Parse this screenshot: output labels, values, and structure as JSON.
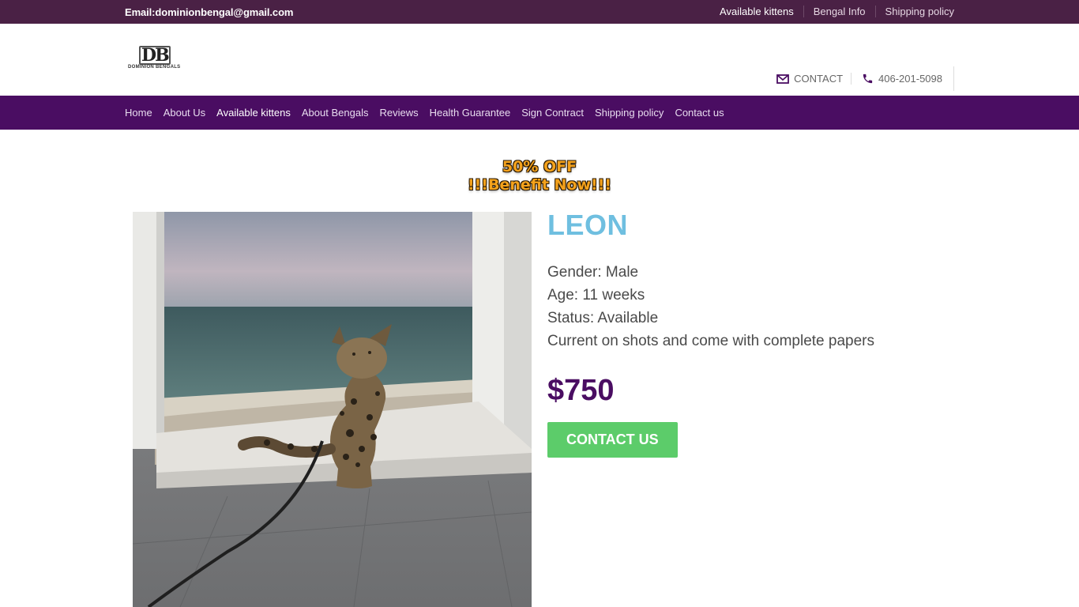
{
  "topbar": {
    "email": "Email:dominionbengal@gmail.com",
    "links": [
      "Available kittens",
      "Bengal Info",
      "Shipping policy"
    ]
  },
  "header": {
    "logo_mark": "DB",
    "logo_text": "DOMINION BENGALS",
    "contact_label": "CONTACT",
    "phone": "406-201-5098",
    "icons": [
      "envelope-icon",
      "phone-icon"
    ]
  },
  "nav": {
    "items": [
      "Home",
      "About Us",
      "Available kittens",
      "About Bengals",
      "Reviews",
      "Health Guarantee",
      "Sign Contract",
      "Shipping policy",
      "Contact us"
    ]
  },
  "banner": {
    "line1": "50% OFF",
    "line2": "!!!Benefit Now!!!"
  },
  "product": {
    "name": "LEON",
    "gender": "Gender: Male",
    "age": "Age: 11 weeks",
    "status": "Status: Available",
    "note": "Current on shots and come with complete papers",
    "price": "$750",
    "cta_label": "CONTACT US"
  },
  "colors": {
    "topbar": "#4a2145",
    "nav": "#4a0d62",
    "name": "#6fbfe0",
    "price": "#4a0d62",
    "cta": "#5ccc6a"
  }
}
